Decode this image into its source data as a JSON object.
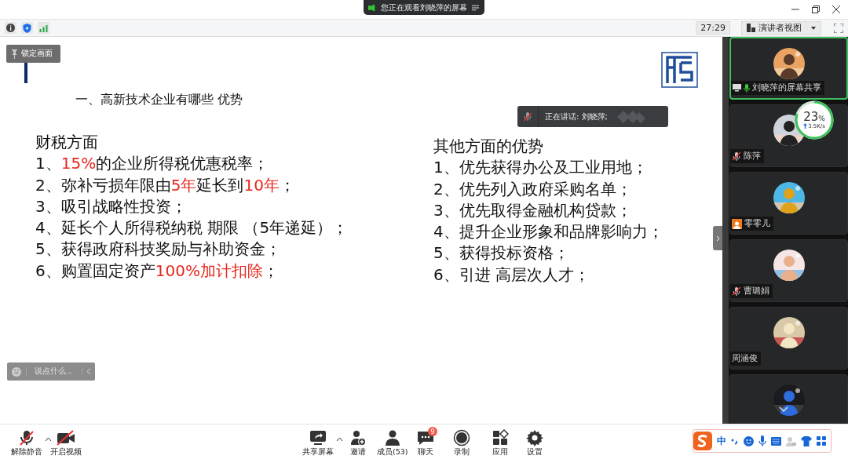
{
  "window": {
    "viewing_banner": "您正在观看刘晓萍的屏幕"
  },
  "toolbar": {
    "timer": "27:29",
    "view_menu": "演讲者视图"
  },
  "lock_tooltip": "锁定画面",
  "slide": {
    "heading": "一、高新技术企业有哪些 优势",
    "columns": [
      {
        "title": "财税方面",
        "items": [
          [
            {
              "text": "1、",
              "highlight": false
            },
            {
              "text": "15%",
              "highlight": true
            },
            {
              "text": "的企业所得税优惠税率；",
              "highlight": false
            }
          ],
          [
            {
              "text": "2、弥补亏损年限由",
              "highlight": false
            },
            {
              "text": "5年",
              "highlight": true
            },
            {
              "text": "延长到",
              "highlight": false
            },
            {
              "text": "10年",
              "highlight": true
            },
            {
              "text": "；",
              "highlight": false
            }
          ],
          [
            {
              "text": "3、吸引战略性投资；",
              "highlight": false
            }
          ],
          [
            {
              "text": "4、延长个人所得税纳税 期限 （5年递延）；",
              "highlight": false
            }
          ],
          [
            {
              "text": "5、获得政府科技奖励与补助资金；",
              "highlight": false
            }
          ],
          [
            {
              "text": "6、购置固定资产",
              "highlight": false
            },
            {
              "text": "100%加计扣除",
              "highlight": true
            },
            {
              "text": "；",
              "highlight": false
            }
          ]
        ]
      },
      {
        "title": "其他方面的优势",
        "items": [
          [
            {
              "text": "1、优先获得办公及工业用地；",
              "highlight": false
            }
          ],
          [
            {
              "text": "2、优先列入政府采购名单；",
              "highlight": false
            }
          ],
          [
            {
              "text": "3、优先取得金融机构贷款；",
              "highlight": false
            }
          ],
          [
            {
              "text": "4、提升企业形象和品牌影响力；",
              "highlight": false
            }
          ],
          [
            {
              "text": "5、获得投标资格；",
              "highlight": false
            }
          ],
          [
            {
              "text": "6、引进 高层次人才；",
              "highlight": false
            }
          ]
        ]
      }
    ]
  },
  "speaker_notice": "正在讲话: 刘晓萍;",
  "chat_input": {
    "placeholder": "说点什么..."
  },
  "network": {
    "percent": "23",
    "unit": "%",
    "speed": "3.5K/s"
  },
  "participants": [
    {
      "name": "刘晓萍的屏幕共享",
      "kind": "sharing",
      "selected": true
    },
    {
      "name": "陈萍",
      "kind": "muted",
      "selected": false
    },
    {
      "name": "零零儿",
      "kind": "no-audio",
      "selected": false
    },
    {
      "name": "曹璐娟",
      "kind": "muted",
      "selected": false
    },
    {
      "name": "周涵俊",
      "kind": "plain",
      "selected": false
    },
    {
      "kind": "partial",
      "selected": false
    }
  ],
  "controls": [
    {
      "label": "解除静音",
      "kind": "mic-off",
      "caret": true
    },
    {
      "label": "开启视频",
      "kind": "video-off",
      "caret": false
    },
    {
      "label": "共享屏幕",
      "kind": "share",
      "caret": true
    },
    {
      "label": "邀请",
      "kind": "invite",
      "caret": false
    },
    {
      "label": "成员(53)",
      "kind": "members",
      "caret": false
    },
    {
      "label": "聊天",
      "kind": "chat",
      "caret": false,
      "badge": "9"
    },
    {
      "label": "录制",
      "kind": "record",
      "caret": false
    },
    {
      "label": "应用",
      "kind": "apps",
      "caret": false
    },
    {
      "label": "设置",
      "kind": "settings",
      "caret": false
    }
  ],
  "ime": {
    "mode": "中"
  }
}
